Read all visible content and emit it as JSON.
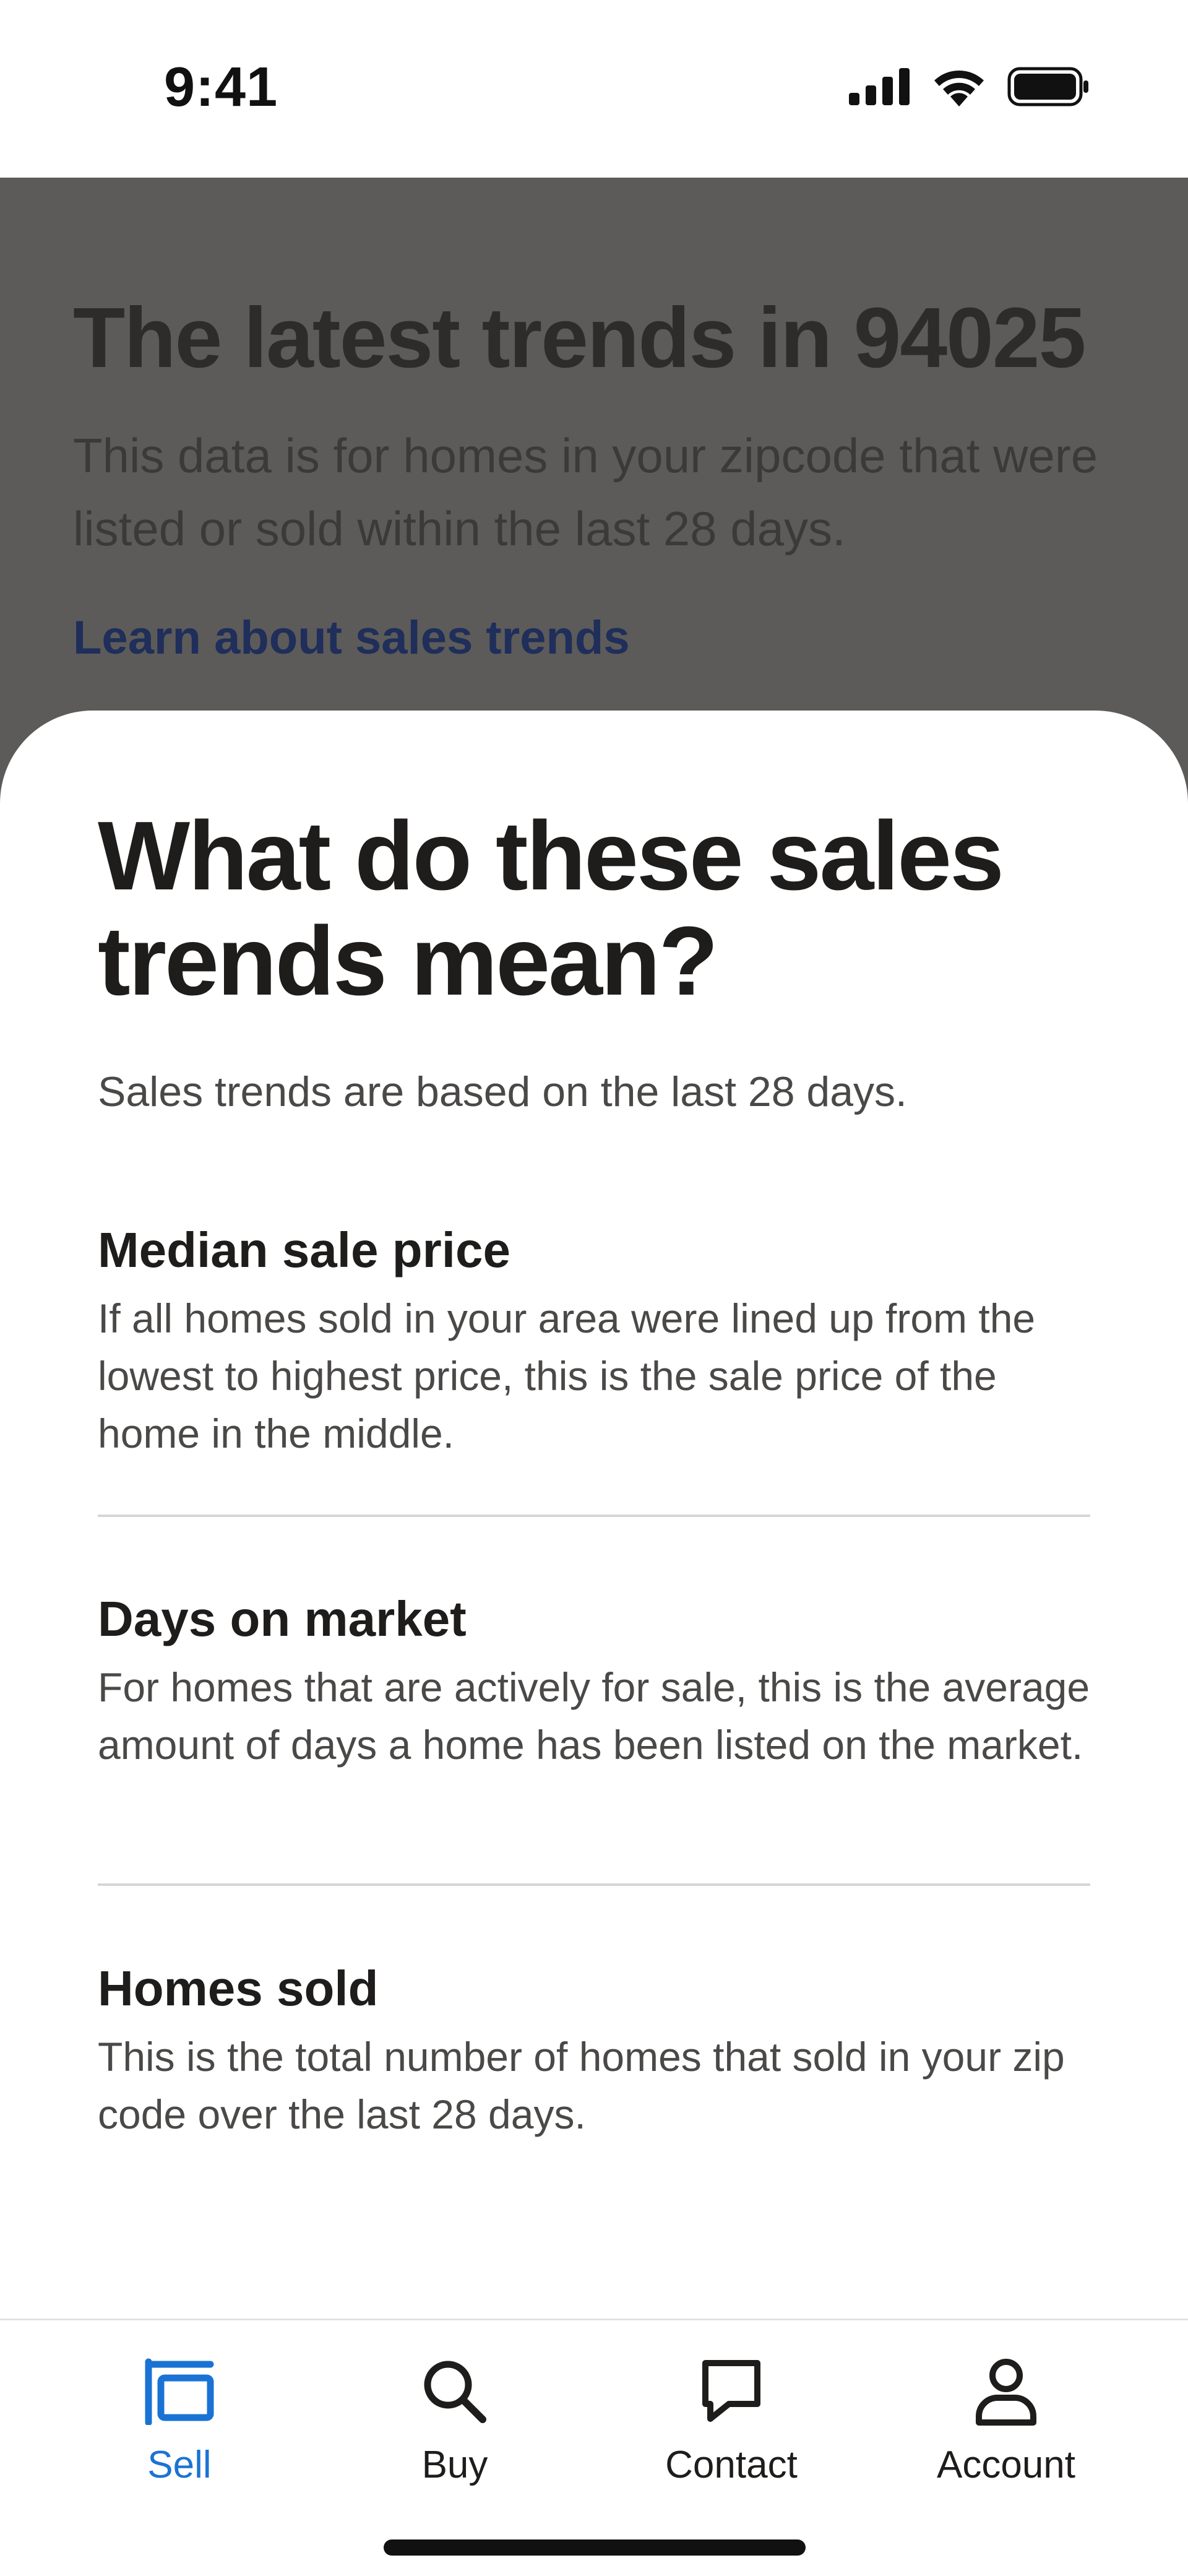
{
  "status_bar": {
    "time": "9:41"
  },
  "background_page": {
    "title": "The latest trends in 94025",
    "description": "This data is for homes in your zipcode that were listed or sold within the last 28 days.",
    "link": "Learn about sales trends"
  },
  "sheet": {
    "title": "What do these sales trends mean?",
    "subtitle": "Sales trends are based on the last 28 days.",
    "sections": [
      {
        "title": "Median sale price",
        "body": "If all homes sold in your area were lined up from the lowest to highest price, this is the sale price of the home in the middle."
      },
      {
        "title": "Days on market",
        "body": "For homes that are actively for sale, this is the average amount of days a home has been listed on the market."
      },
      {
        "title": "Homes sold",
        "body": "This is the total number of homes that sold in your zip code over the last 28 days."
      }
    ]
  },
  "tab_bar": {
    "active_color": "#1a73d4",
    "items": [
      {
        "label": "Sell",
        "icon": "sell-icon",
        "active": true
      },
      {
        "label": "Buy",
        "icon": "search-icon",
        "active": false
      },
      {
        "label": "Contact",
        "icon": "chat-icon",
        "active": false
      },
      {
        "label": "Account",
        "icon": "person-icon",
        "active": false
      }
    ]
  }
}
